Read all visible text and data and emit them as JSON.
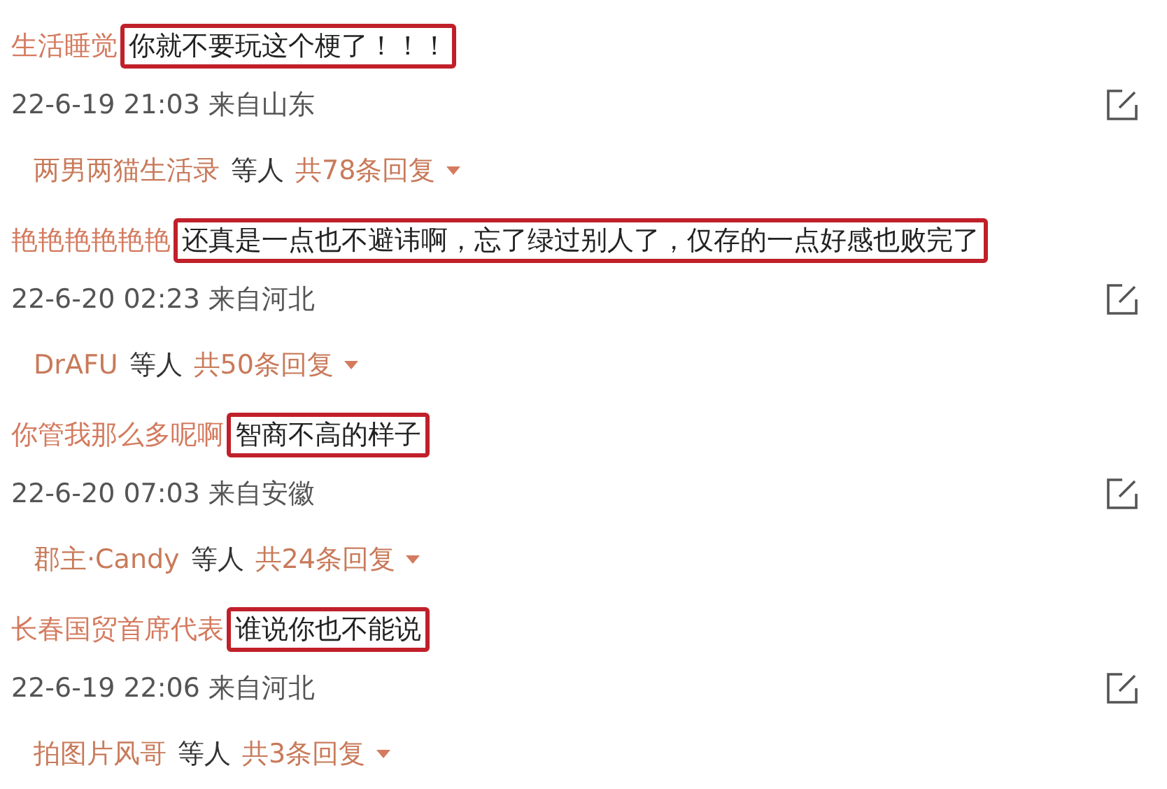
{
  "comments": [
    {
      "user": "生活睡觉",
      "text": "你就不要玩这个梗了！！！",
      "highlighted": true,
      "meta": "22-6-19 21:03 来自山东",
      "repliers": "两男两猫生活录",
      "others": "等人",
      "reply_count": "共78条回复"
    },
    {
      "user": "艳艳艳艳艳艳",
      "text": "还真是一点也不避讳啊，忘了绿过别人了，仅存的一点好感也败完了",
      "highlighted": true,
      "meta": "22-6-20 02:23 来自河北",
      "repliers": "DrAFU",
      "others": "等人",
      "reply_count": "共50条回复"
    },
    {
      "user": "你管我那么多呢啊",
      "text": "智商不高的样子",
      "highlighted": true,
      "meta": "22-6-20 07:03 来自安徽",
      "repliers": "郡主·Candy",
      "others": "等人",
      "reply_count": "共24条回复"
    },
    {
      "user": "长春国贸首席代表",
      "text": "谁说你也不能说",
      "highlighted": true,
      "meta": "22-6-19 22:06 来自河北",
      "repliers": "拍图片风哥",
      "others": "等人",
      "reply_count": "共3条回复"
    }
  ]
}
